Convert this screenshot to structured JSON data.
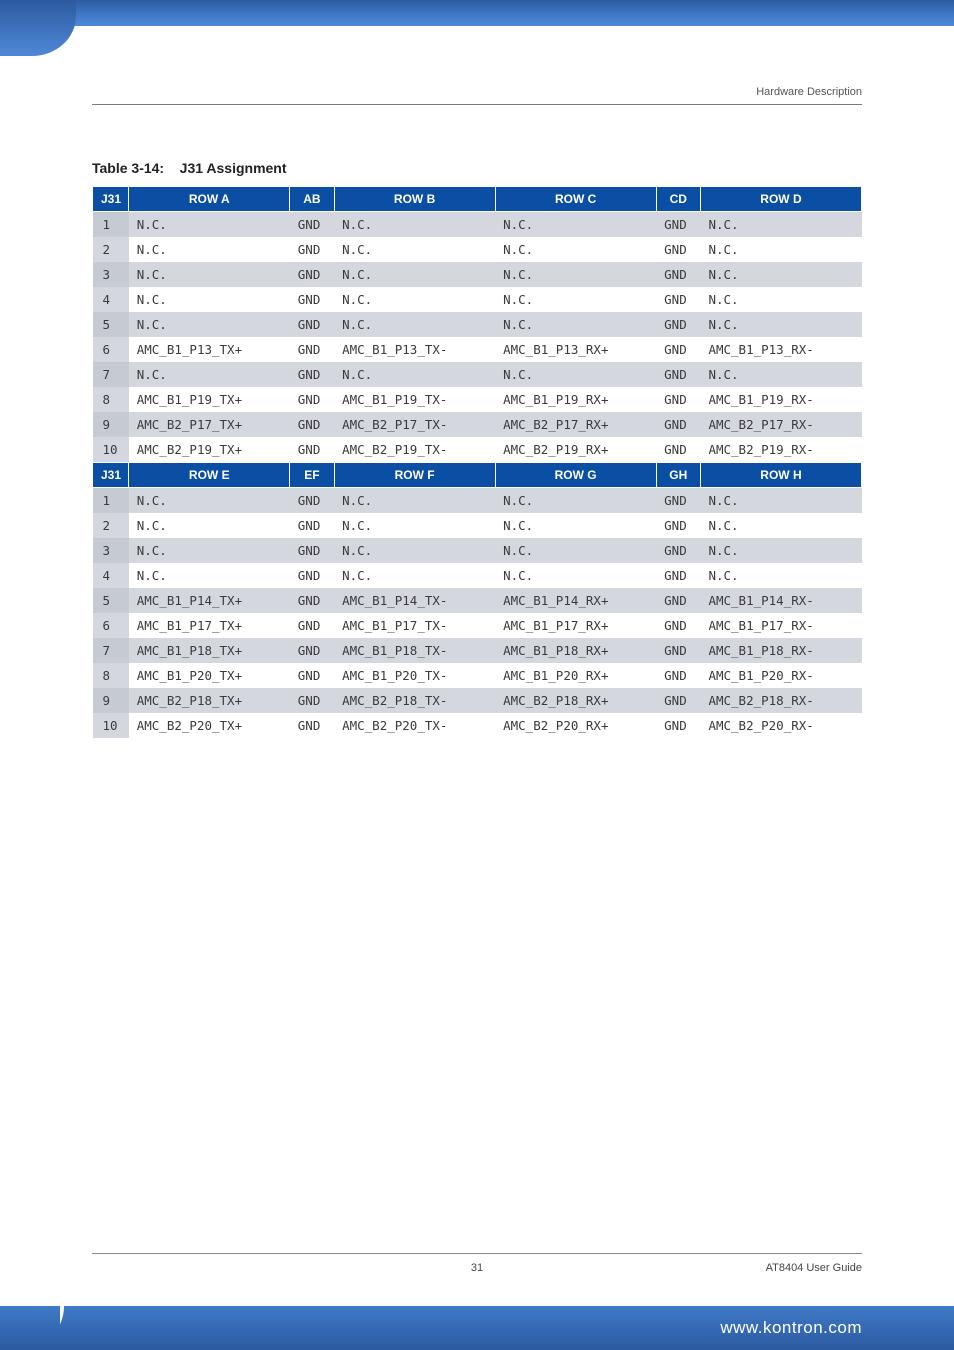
{
  "header": {
    "section": "Hardware Description"
  },
  "table": {
    "title_prefix": "Table 3-14:",
    "title": "J31 Assignment",
    "head1": {
      "j31": "J31",
      "a": "ROW A",
      "ab": "AB",
      "b": "ROW B",
      "c": "ROW C",
      "cd": "CD",
      "d": "ROW D"
    },
    "head2": {
      "j31": "J31",
      "e": "ROW E",
      "ef": "EF",
      "f": "ROW F",
      "g": "ROW G",
      "gh": "GH",
      "h": "ROW H"
    },
    "block1": [
      {
        "j31": "1",
        "a": "N.C.",
        "ab": "GND",
        "b": "N.C.",
        "c": "N.C.",
        "cd": "GND",
        "d": "N.C."
      },
      {
        "j31": "2",
        "a": "N.C.",
        "ab": "GND",
        "b": "N.C.",
        "c": "N.C.",
        "cd": "GND",
        "d": "N.C."
      },
      {
        "j31": "3",
        "a": "N.C.",
        "ab": "GND",
        "b": "N.C.",
        "c": "N.C.",
        "cd": "GND",
        "d": "N.C."
      },
      {
        "j31": "4",
        "a": "N.C.",
        "ab": "GND",
        "b": "N.C.",
        "c": "N.C.",
        "cd": "GND",
        "d": "N.C."
      },
      {
        "j31": "5",
        "a": "N.C.",
        "ab": "GND",
        "b": "N.C.",
        "c": "N.C.",
        "cd": "GND",
        "d": "N.C."
      },
      {
        "j31": "6",
        "a": "AMC_B1_P13_TX+",
        "ab": "GND",
        "b": "AMC_B1_P13_TX-",
        "c": "AMC_B1_P13_RX+",
        "cd": "GND",
        "d": "AMC_B1_P13_RX-"
      },
      {
        "j31": "7",
        "a": "N.C.",
        "ab": "GND",
        "b": "N.C.",
        "c": "N.C.",
        "cd": "GND",
        "d": "N.C."
      },
      {
        "j31": "8",
        "a": "AMC_B1_P19_TX+",
        "ab": "GND",
        "b": "AMC_B1_P19_TX-",
        "c": "AMC_B1_P19_RX+",
        "cd": "GND",
        "d": "AMC_B1_P19_RX-"
      },
      {
        "j31": "9",
        "a": "AMC_B2_P17_TX+",
        "ab": "GND",
        "b": "AMC_B2_P17_TX-",
        "c": "AMC_B2_P17_RX+",
        "cd": "GND",
        "d": "AMC_B2_P17_RX-"
      },
      {
        "j31": "10",
        "a": "AMC_B2_P19_TX+",
        "ab": "GND",
        "b": "AMC_B2_P19_TX-",
        "c": "AMC_B2_P19_RX+",
        "cd": "GND",
        "d": "AMC_B2_P19_RX-"
      }
    ],
    "block2": [
      {
        "j31": "1",
        "e": "N.C.",
        "ef": "GND",
        "f": "N.C.",
        "g": "N.C.",
        "gh": "GND",
        "h": "N.C."
      },
      {
        "j31": "2",
        "e": "N.C.",
        "ef": "GND",
        "f": "N.C.",
        "g": "N.C.",
        "gh": "GND",
        "h": "N.C."
      },
      {
        "j31": "3",
        "e": "N.C.",
        "ef": "GND",
        "f": "N.C.",
        "g": "N.C.",
        "gh": "GND",
        "h": "N.C."
      },
      {
        "j31": "4",
        "e": "N.C.",
        "ef": "GND",
        "f": "N.C.",
        "g": "N.C.",
        "gh": "GND",
        "h": "N.C."
      },
      {
        "j31": "5",
        "e": "AMC_B1_P14_TX+",
        "ef": "GND",
        "f": "AMC_B1_P14_TX-",
        "g": "AMC_B1_P14_RX+",
        "gh": "GND",
        "h": "AMC_B1_P14_RX-"
      },
      {
        "j31": "6",
        "e": "AMC_B1_P17_TX+",
        "ef": "GND",
        "f": "AMC_B1_P17_TX-",
        "g": "AMC_B1_P17_RX+",
        "gh": "GND",
        "h": "AMC_B1_P17_RX-"
      },
      {
        "j31": "7",
        "e": "AMC_B1_P18_TX+",
        "ef": "GND",
        "f": "AMC_B1_P18_TX-",
        "g": "AMC_B1_P18_RX+",
        "gh": "GND",
        "h": "AMC_B1_P18_RX-"
      },
      {
        "j31": "8",
        "e": "AMC_B1_P20_TX+",
        "ef": "GND",
        "f": "AMC_B1_P20_TX-",
        "g": "AMC_B1_P20_RX+",
        "gh": "GND",
        "h": "AMC_B1_P20_RX-"
      },
      {
        "j31": "9",
        "e": "AMC_B2_P18_TX+",
        "ef": "GND",
        "f": "AMC_B2_P18_TX-",
        "g": "AMC_B2_P18_RX+",
        "gh": "GND",
        "h": "AMC_B2_P18_RX-"
      },
      {
        "j31": "10",
        "e": "AMC_B2_P20_TX+",
        "ef": "GND",
        "f": "AMC_B2_P20_TX-",
        "g": "AMC_B2_P20_RX+",
        "gh": "GND",
        "h": "AMC_B2_P20_RX-"
      }
    ]
  },
  "footer": {
    "page": "31",
    "guide": "AT8404 User  Guide",
    "url": "www.kontron.com"
  },
  "chart_data": {
    "type": "table",
    "title": "Table 3-14: J31 Assignment",
    "columns_block1": [
      "J31",
      "ROW A",
      "AB",
      "ROW B",
      "ROW C",
      "CD",
      "ROW D"
    ],
    "rows_block1": [
      [
        "1",
        "N.C.",
        "GND",
        "N.C.",
        "N.C.",
        "GND",
        "N.C."
      ],
      [
        "2",
        "N.C.",
        "GND",
        "N.C.",
        "N.C.",
        "GND",
        "N.C."
      ],
      [
        "3",
        "N.C.",
        "GND",
        "N.C.",
        "N.C.",
        "GND",
        "N.C."
      ],
      [
        "4",
        "N.C.",
        "GND",
        "N.C.",
        "N.C.",
        "GND",
        "N.C."
      ],
      [
        "5",
        "N.C.",
        "GND",
        "N.C.",
        "N.C.",
        "GND",
        "N.C."
      ],
      [
        "6",
        "AMC_B1_P13_TX+",
        "GND",
        "AMC_B1_P13_TX-",
        "AMC_B1_P13_RX+",
        "GND",
        "AMC_B1_P13_RX-"
      ],
      [
        "7",
        "N.C.",
        "GND",
        "N.C.",
        "N.C.",
        "GND",
        "N.C."
      ],
      [
        "8",
        "AMC_B1_P19_TX+",
        "GND",
        "AMC_B1_P19_TX-",
        "AMC_B1_P19_RX+",
        "GND",
        "AMC_B1_P19_RX-"
      ],
      [
        "9",
        "AMC_B2_P17_TX+",
        "GND",
        "AMC_B2_P17_TX-",
        "AMC_B2_P17_RX+",
        "GND",
        "AMC_B2_P17_RX-"
      ],
      [
        "10",
        "AMC_B2_P19_TX+",
        "GND",
        "AMC_B2_P19_TX-",
        "AMC_B2_P19_RX+",
        "GND",
        "AMC_B2_P19_RX-"
      ]
    ],
    "columns_block2": [
      "J31",
      "ROW E",
      "EF",
      "ROW F",
      "ROW G",
      "GH",
      "ROW H"
    ],
    "rows_block2": [
      [
        "1",
        "N.C.",
        "GND",
        "N.C.",
        "N.C.",
        "GND",
        "N.C."
      ],
      [
        "2",
        "N.C.",
        "GND",
        "N.C.",
        "N.C.",
        "GND",
        "N.C."
      ],
      [
        "3",
        "N.C.",
        "GND",
        "N.C.",
        "N.C.",
        "GND",
        "N.C."
      ],
      [
        "4",
        "N.C.",
        "GND",
        "N.C.",
        "N.C.",
        "GND",
        "N.C."
      ],
      [
        "5",
        "AMC_B1_P14_TX+",
        "GND",
        "AMC_B1_P14_TX-",
        "AMC_B1_P14_RX+",
        "GND",
        "AMC_B1_P14_RX-"
      ],
      [
        "6",
        "AMC_B1_P17_TX+",
        "GND",
        "AMC_B1_P17_TX-",
        "AMC_B1_P17_RX+",
        "GND",
        "AMC_B1_P17_RX-"
      ],
      [
        "7",
        "AMC_B1_P18_TX+",
        "GND",
        "AMC_B1_P18_TX-",
        "AMC_B1_P18_RX+",
        "GND",
        "AMC_B1_P18_RX-"
      ],
      [
        "8",
        "AMC_B1_P20_TX+",
        "GND",
        "AMC_B1_P20_TX-",
        "AMC_B1_P20_RX+",
        "GND",
        "AMC_B1_P20_RX-"
      ],
      [
        "9",
        "AMC_B2_P18_TX+",
        "GND",
        "AMC_B2_P18_TX-",
        "AMC_B2_P18_RX+",
        "GND",
        "AMC_B2_P18_RX-"
      ],
      [
        "10",
        "AMC_B2_P20_TX+",
        "GND",
        "AMC_B2_P20_TX-",
        "AMC_B2_P20_RX+",
        "GND",
        "AMC_B2_P20_RX-"
      ]
    ]
  }
}
